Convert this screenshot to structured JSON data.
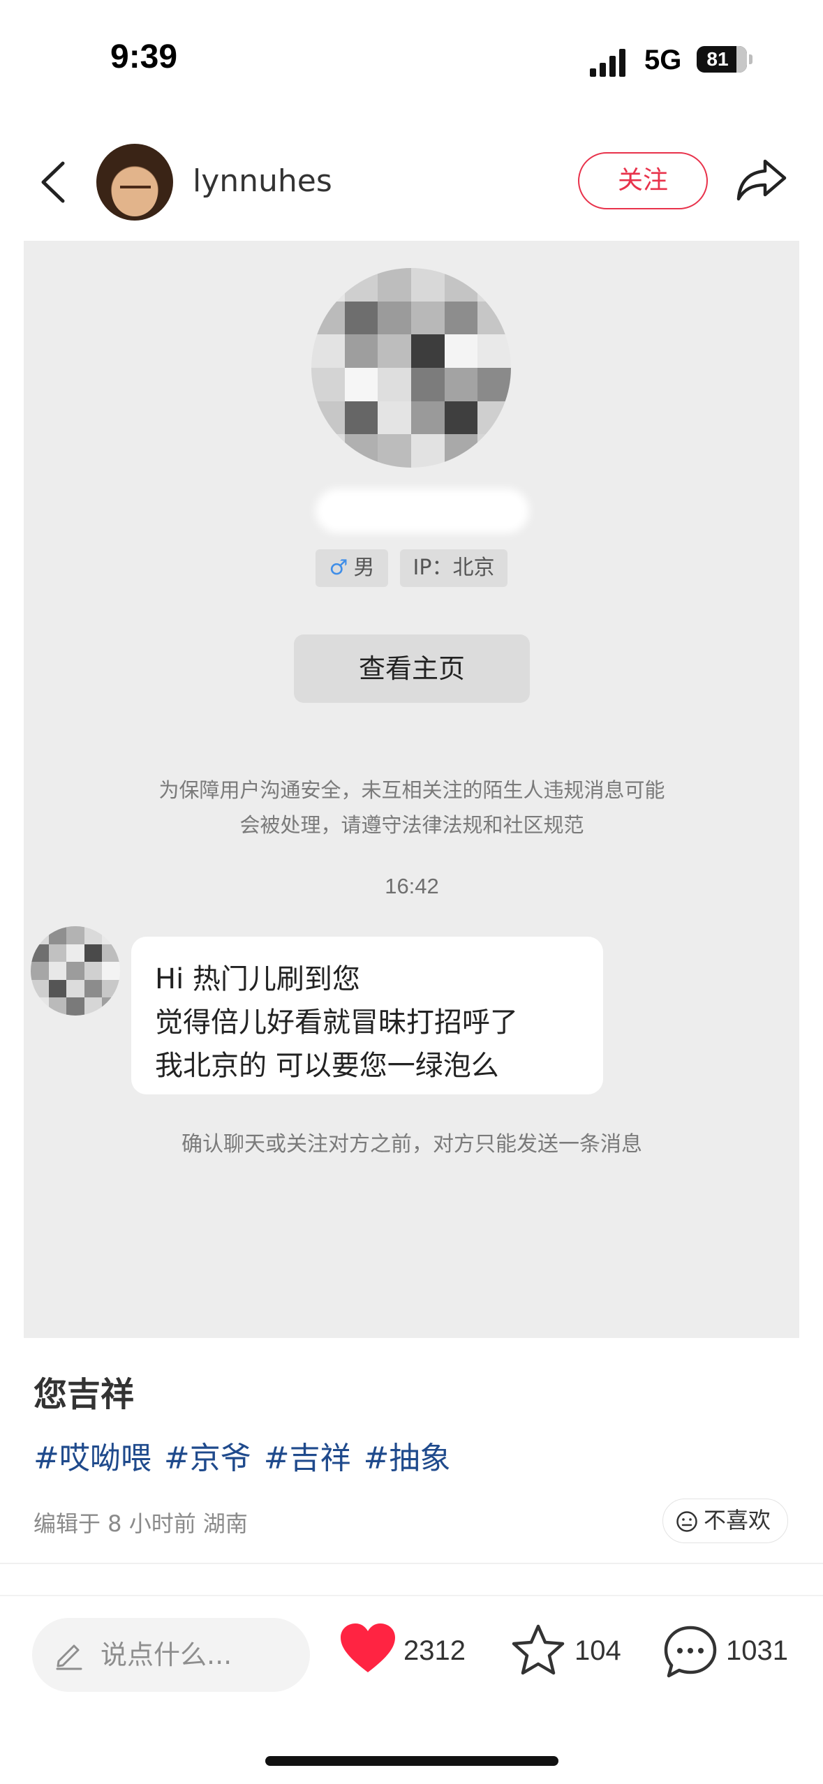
{
  "status_bar": {
    "time": "9:39",
    "network": "5G",
    "battery": "81",
    "battery_level": 0.81
  },
  "header": {
    "username": "lynnuhes",
    "follow_label": "关注"
  },
  "profile_card": {
    "gender_symbol": "♂",
    "gender": "男",
    "ip": "IP：北京",
    "view_home_label": "查看主页",
    "notice_line1": "为保障用户沟通安全，未互相关注的陌生人违规消息可能",
    "notice_line2": "会被处理，请遵守法律法规和社区规范",
    "time": "16:42",
    "message_lines": [
      "Hi 热门儿刷到您",
      "觉得倍儿好看就冒昧打招呼了",
      "我北京的 可以要您一绿泡么"
    ],
    "tip": "确认聊天或关注对方之前，对方只能发送一条消息"
  },
  "post": {
    "title": "您吉祥",
    "hashtags": [
      "#哎呦喂",
      "#京爷",
      "#吉祥",
      "#抽象"
    ],
    "meta": "编辑于 8 小时前 湖南",
    "dislike_label": "不喜欢"
  },
  "bottom_bar": {
    "comment_placeholder": "说点什么...",
    "likes": "2312",
    "stars": "104",
    "comments": "1031",
    "heart_color": "#ff2442"
  },
  "icons": [
    "back-icon",
    "share-icon",
    "pencil-icon",
    "heart-icon",
    "star-icon",
    "comment-icon",
    "neutral-face-icon"
  ]
}
